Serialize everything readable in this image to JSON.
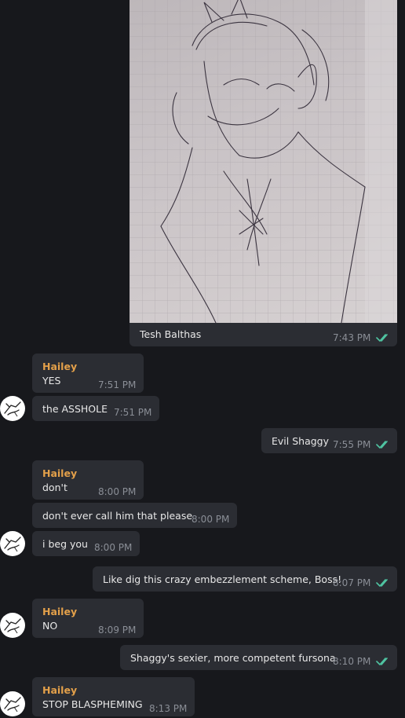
{
  "theme": {
    "background": "#17181c",
    "bubble": "#2b2d33",
    "sender_color": "#e3a04a",
    "check_color": "#4fc3a1",
    "time_color": "#8a8e96"
  },
  "photo_message": {
    "caption": "Tesh Balthas",
    "time": "7:43 PM",
    "status_icon": "double-check-icon"
  },
  "messages": [
    {
      "sender": "Hailey",
      "text": "YES",
      "time": "7:51 PM"
    },
    {
      "text": "the ASSHOLE",
      "time": "7:51 PM"
    },
    {
      "text": "Evil Shaggy",
      "time": "7:55 PM"
    },
    {
      "sender": "Hailey",
      "text": "don't",
      "time": "8:00 PM"
    },
    {
      "text": "don't ever call him that please",
      "time": "8:00 PM"
    },
    {
      "text": "i beg you",
      "time": "8:00 PM"
    },
    {
      "text": "Like dig this crazy embezzlement scheme, Boss!",
      "time": "8:07 PM"
    },
    {
      "sender": "Hailey",
      "text": "NO",
      "time": "8:09 PM"
    },
    {
      "text": "Shaggy's sexier, more competent fursona",
      "time": "8:10 PM"
    },
    {
      "sender": "Hailey",
      "text": "STOP BLASPHEMING",
      "time": "8:13 PM"
    }
  ]
}
